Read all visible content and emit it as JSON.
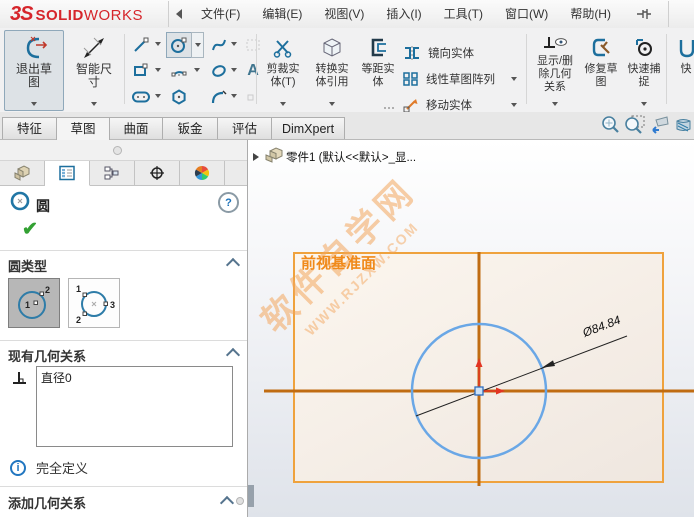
{
  "titlebar": {
    "logo_prefix": "3S",
    "logo_solid": "SOLID",
    "logo_works": "WORKS",
    "menus": [
      "文件(F)",
      "编辑(E)",
      "视图(V)",
      "插入(I)",
      "工具(T)",
      "窗口(W)",
      "帮助(H)"
    ]
  },
  "toolbar": {
    "exit_sketch": "退出草图",
    "smart_dimension": "智能尺寸",
    "trim": "剪裁实体(T)",
    "convert": "转换实体引用",
    "offset": "等距实体",
    "mirror": "镜向实体",
    "linear_pattern": "线性草图阵列",
    "move": "移动实体",
    "display_relations": "显示/删除几何关系",
    "repair_sketch": "修复草图",
    "quick_snaps": "快速捕捉",
    "rapid_sketch_partial": "快"
  },
  "ribbon_tabs": [
    "特征",
    "草图",
    "曲面",
    "钣金",
    "评估",
    "DimXpert"
  ],
  "property_manager": {
    "title": "圆",
    "help": "?",
    "sections": {
      "circle_type": "圆类型",
      "existing_relations": "现有几何关系",
      "add_relations": "添加几何关系"
    },
    "type_buttons": {
      "center": [
        "1",
        "2"
      ],
      "perimeter": [
        "1",
        "2",
        "3"
      ]
    },
    "relations_list": [
      "直径0"
    ],
    "status": "完全定义"
  },
  "graphics": {
    "tree_item": "零件1 (默认<<默认>_显...",
    "plane_label": "前视基准面",
    "dimension": "Ø84.84",
    "watermark_line1": "软件自学网",
    "watermark_line2": "WWW.RJZXW.COM"
  },
  "icons": {
    "check": "✔",
    "info": "i",
    "text_tool": "A"
  }
}
